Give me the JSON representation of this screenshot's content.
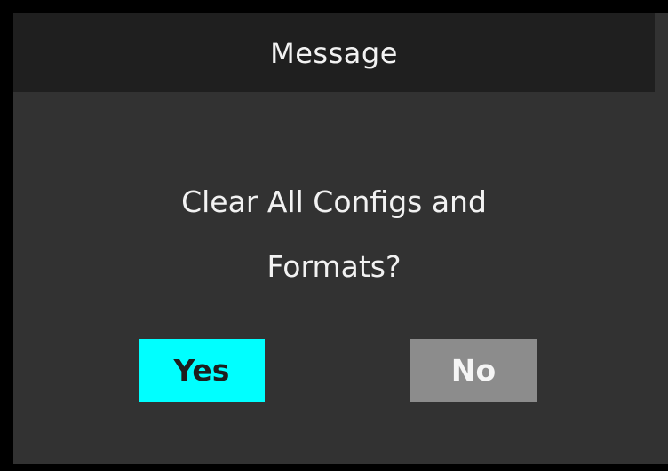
{
  "dialog": {
    "title": "Message",
    "message_line_1": "Clear All Configs and",
    "message_line_2": "Formats?",
    "yes_label": "Yes",
    "no_label": "No"
  },
  "colors": {
    "background": "#323232",
    "title_bar": "#1f1f1f",
    "yes_button": "#00ffff",
    "no_button": "#8c8c8c",
    "text": "#f2f2f2"
  }
}
